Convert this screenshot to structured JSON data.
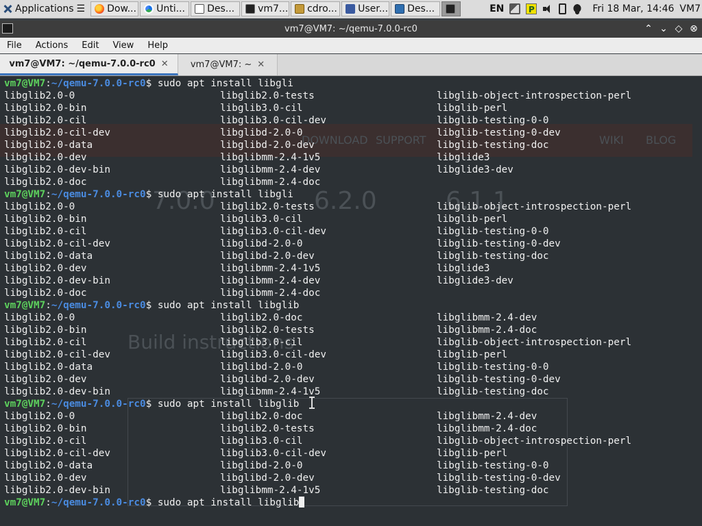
{
  "panel": {
    "applications_label": "Applications",
    "tasks": [
      {
        "label": "Dow...",
        "icon": "firefox-icon"
      },
      {
        "label": "Unti...",
        "icon": "chrome-icon"
      },
      {
        "label": "Des...",
        "icon": "window-icon"
      },
      {
        "label": "vm7...",
        "icon": "terminal-icon"
      },
      {
        "label": "cdro...",
        "icon": "folder-icon"
      },
      {
        "label": "User...",
        "icon": "user-icon"
      },
      {
        "label": "Des...",
        "icon": "desktop-icon"
      },
      {
        "label": "",
        "icon": "terminal-icon"
      }
    ],
    "keyboard_layout": "EN",
    "datetime": "Fri 18 Mar, 14:46",
    "user": "VM7"
  },
  "window": {
    "title": "vm7@VM7: ~/qemu-7.0.0-rc0"
  },
  "menu": [
    "File",
    "Actions",
    "Edit",
    "View",
    "Help"
  ],
  "tabs": [
    {
      "label": "vm7@VM7: ~/qemu-7.0.0-rc0",
      "active": true
    },
    {
      "label": "vm7@VM7: ~",
      "active": false
    }
  ],
  "terminal": {
    "prompt_user": "vm7@VM7",
    "prompt_path": "~/qemu-7.0.0-rc0",
    "blocks": [
      {
        "command": "sudo apt install libgli",
        "rows": [
          [
            "libglib2.0-0",
            "libglib2.0-tests",
            "libglib-object-introspection-perl"
          ],
          [
            "libglib2.0-bin",
            "libglib3.0-cil",
            "libglib-perl"
          ],
          [
            "libglib2.0-cil",
            "libglib3.0-cil-dev",
            "libglib-testing-0-0"
          ],
          [
            "libglib2.0-cil-dev",
            "libglibd-2.0-0",
            "libglib-testing-0-dev"
          ],
          [
            "libglib2.0-data",
            "libglibd-2.0-dev",
            "libglib-testing-doc"
          ],
          [
            "libglib2.0-dev",
            "libglibmm-2.4-1v5",
            "libglide3"
          ],
          [
            "libglib2.0-dev-bin",
            "libglibmm-2.4-dev",
            "libglide3-dev"
          ],
          [
            "libglib2.0-doc",
            "libglibmm-2.4-doc",
            ""
          ]
        ]
      },
      {
        "command": "sudo apt install libgli",
        "rows": [
          [
            "libglib2.0-0",
            "libglib2.0-tests",
            "libglib-object-introspection-perl"
          ],
          [
            "libglib2.0-bin",
            "libglib3.0-cil",
            "libglib-perl"
          ],
          [
            "libglib2.0-cil",
            "libglib3.0-cil-dev",
            "libglib-testing-0-0"
          ],
          [
            "libglib2.0-cil-dev",
            "libglibd-2.0-0",
            "libglib-testing-0-dev"
          ],
          [
            "libglib2.0-data",
            "libglibd-2.0-dev",
            "libglib-testing-doc"
          ],
          [
            "libglib2.0-dev",
            "libglibmm-2.4-1v5",
            "libglide3"
          ],
          [
            "libglib2.0-dev-bin",
            "libglibmm-2.4-dev",
            "libglide3-dev"
          ],
          [
            "libglib2.0-doc",
            "libglibmm-2.4-doc",
            ""
          ]
        ]
      },
      {
        "command": "sudo apt install libglib",
        "rows": [
          [
            "libglib2.0-0",
            "libglib2.0-doc",
            "libglibmm-2.4-dev"
          ],
          [
            "libglib2.0-bin",
            "libglib2.0-tests",
            "libglibmm-2.4-doc"
          ],
          [
            "libglib2.0-cil",
            "libglib3.0-cil",
            "libglib-object-introspection-perl"
          ],
          [
            "libglib2.0-cil-dev",
            "libglib3.0-cil-dev",
            "libglib-perl"
          ],
          [
            "libglib2.0-data",
            "libglibd-2.0-0",
            "libglib-testing-0-0"
          ],
          [
            "libglib2.0-dev",
            "libglibd-2.0-dev",
            "libglib-testing-0-dev"
          ],
          [
            "libglib2.0-dev-bin",
            "libglibmm-2.4-1v5",
            "libglib-testing-doc"
          ]
        ]
      },
      {
        "command": "sudo apt install libglib",
        "rows": [
          [
            "libglib2.0-0",
            "libglib2.0-doc",
            "libglibmm-2.4-dev"
          ],
          [
            "libglib2.0-bin",
            "libglib2.0-tests",
            "libglibmm-2.4-doc"
          ],
          [
            "libglib2.0-cil",
            "libglib3.0-cil",
            "libglib-object-introspection-perl"
          ],
          [
            "libglib2.0-cil-dev",
            "libglib3.0-cil-dev",
            "libglib-perl"
          ],
          [
            "libglib2.0-data",
            "libglibd-2.0-0",
            "libglib-testing-0-0"
          ],
          [
            "libglib2.0-dev",
            "libglibd-2.0-dev",
            "libglib-testing-0-dev"
          ],
          [
            "libglib2.0-dev-bin",
            "libglibmm-2.4-1v5",
            "libglib-testing-doc"
          ]
        ]
      }
    ],
    "current_command": "sudo apt install libglib"
  },
  "background": {
    "ghost_texts": [
      "7.0.0",
      "6.2.0",
      "6.1.1",
      "DOWNLOAD",
      "SUPPORT",
      "WIKI",
      "BLOG",
      "Build instructions"
    ]
  },
  "colors": {
    "prompt_user": "#5dd15d",
    "prompt_path": "#4a8be0",
    "terminal_bg": "#2c3135",
    "tab_accent": "#3c75bd"
  }
}
